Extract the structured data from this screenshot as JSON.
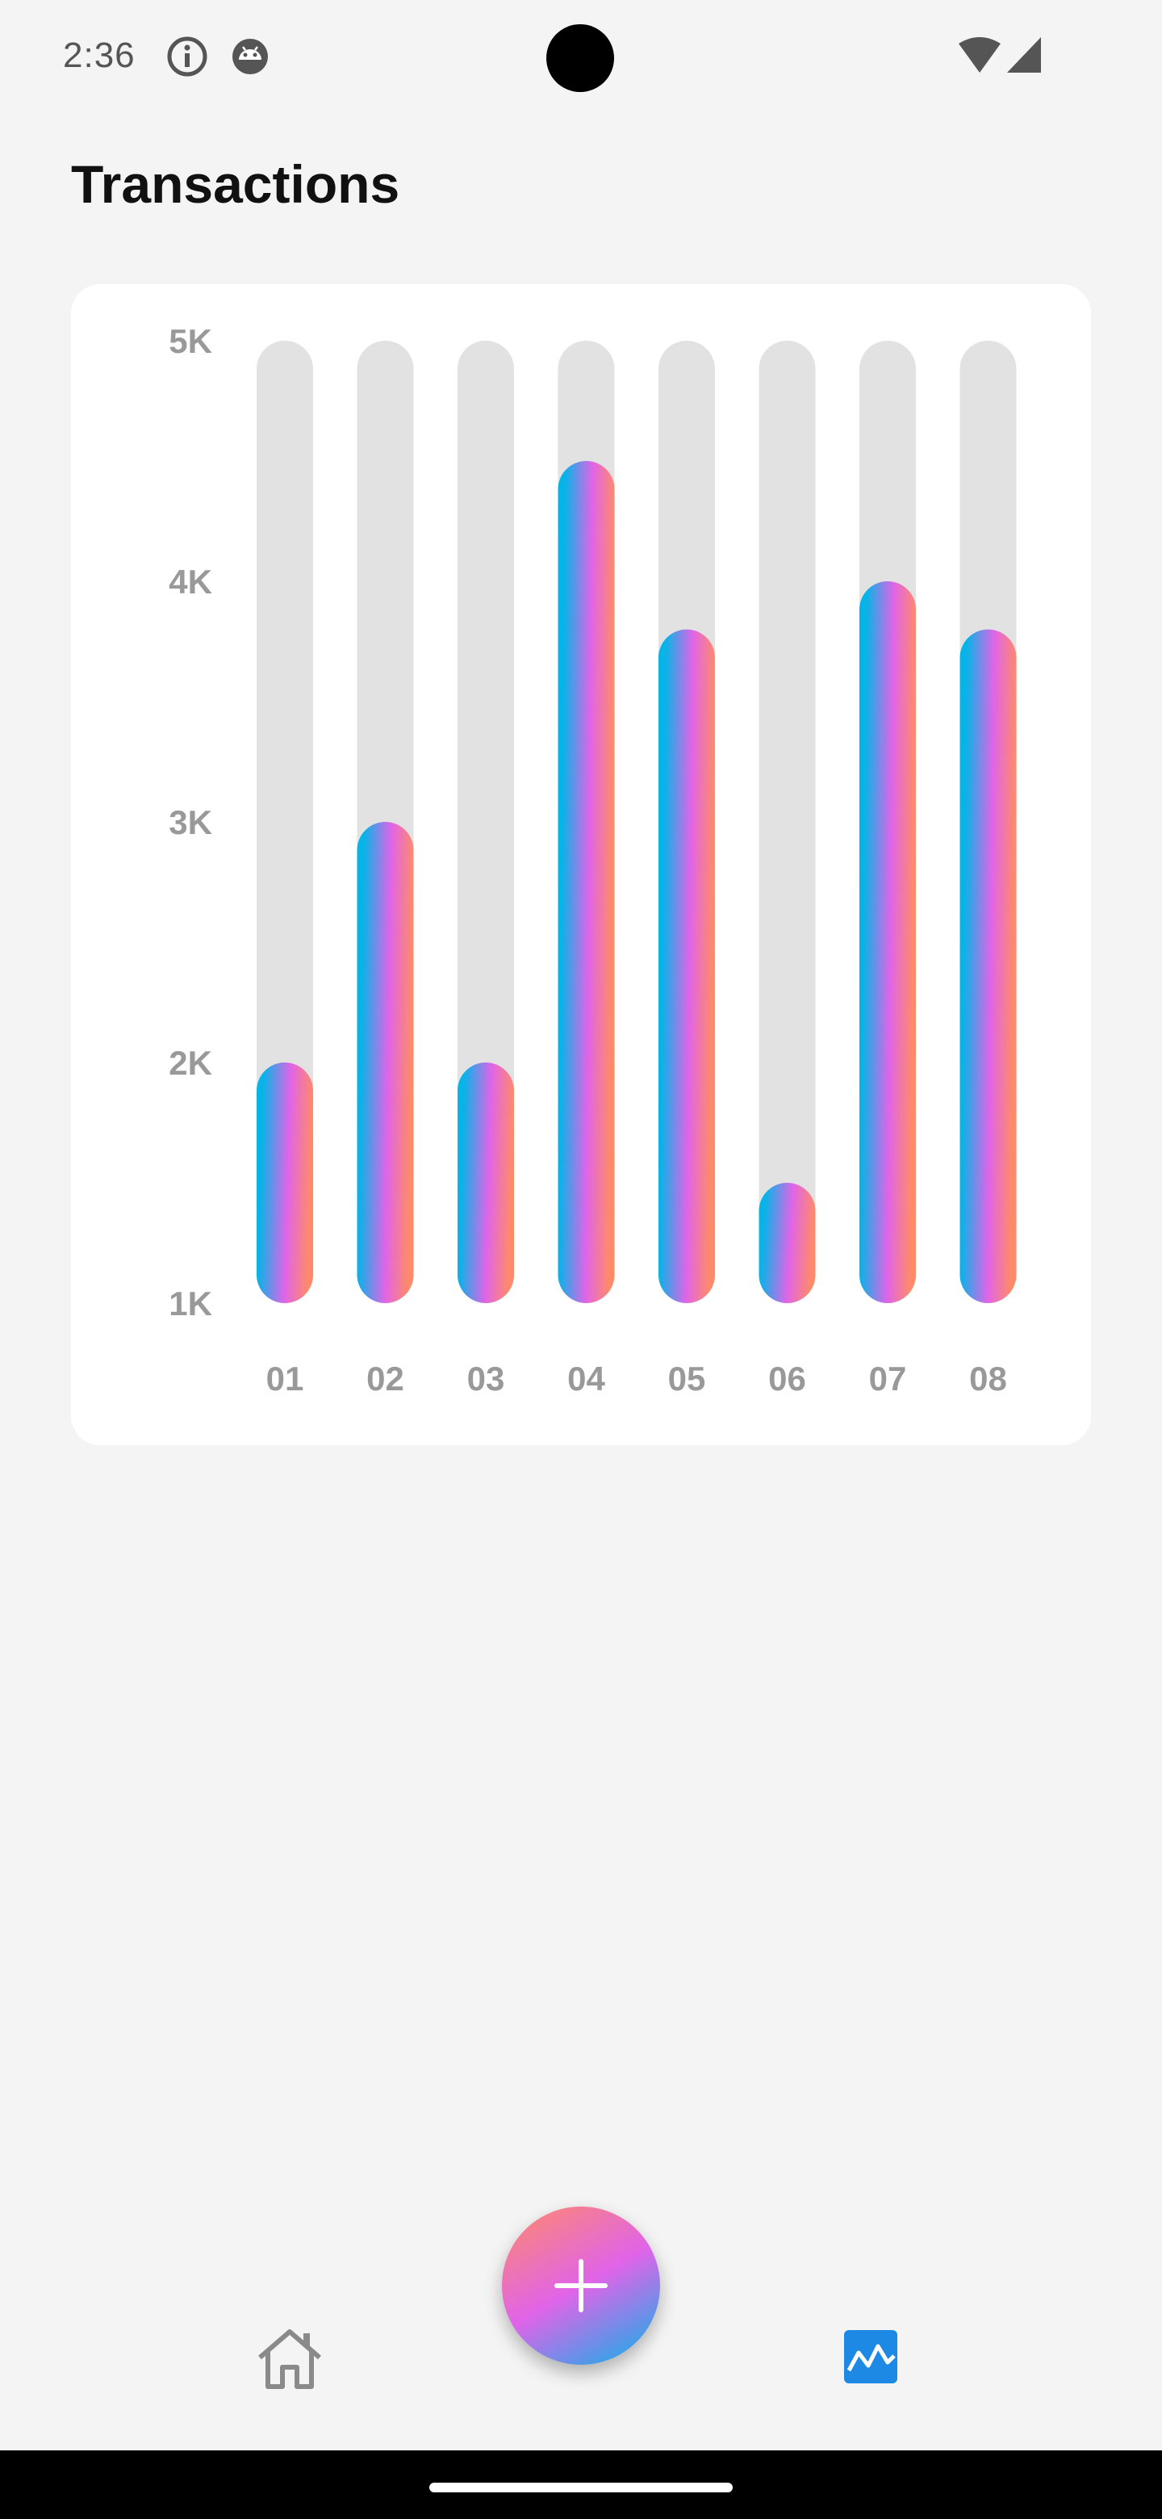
{
  "status_bar": {
    "time": "2:36",
    "icons": [
      "info-icon",
      "android-debug-icon",
      "wifi-icon",
      "signal-icon"
    ]
  },
  "header": {
    "title": "Transactions"
  },
  "chart_data": {
    "type": "bar",
    "categories": [
      "01",
      "02",
      "03",
      "04",
      "05",
      "06",
      "07",
      "08"
    ],
    "values": [
      2000,
      3000,
      2000,
      4500,
      3800,
      1500,
      4000,
      3800
    ],
    "ylim": [
      1000,
      5000
    ],
    "y_ticks": [
      1000,
      2000,
      3000,
      4000,
      5000
    ],
    "y_tick_labels": [
      "1K",
      "2K",
      "3K",
      "4K",
      "5K"
    ],
    "grid": false,
    "title": "",
    "xlabel": "",
    "ylabel": "",
    "colors": {
      "track": "#e2e2e2",
      "gradient": [
        "#06b4e8",
        "#e064e8",
        "#ff8a6a"
      ],
      "tick_label": "#999999"
    }
  },
  "bottom_nav": {
    "items": [
      {
        "icon": "home-icon",
        "active": false,
        "color": "#8a8a8a"
      },
      {
        "icon": "chart-icon",
        "active": true,
        "color": "#1e88e5"
      }
    ],
    "fab_icon": "plus-icon"
  }
}
